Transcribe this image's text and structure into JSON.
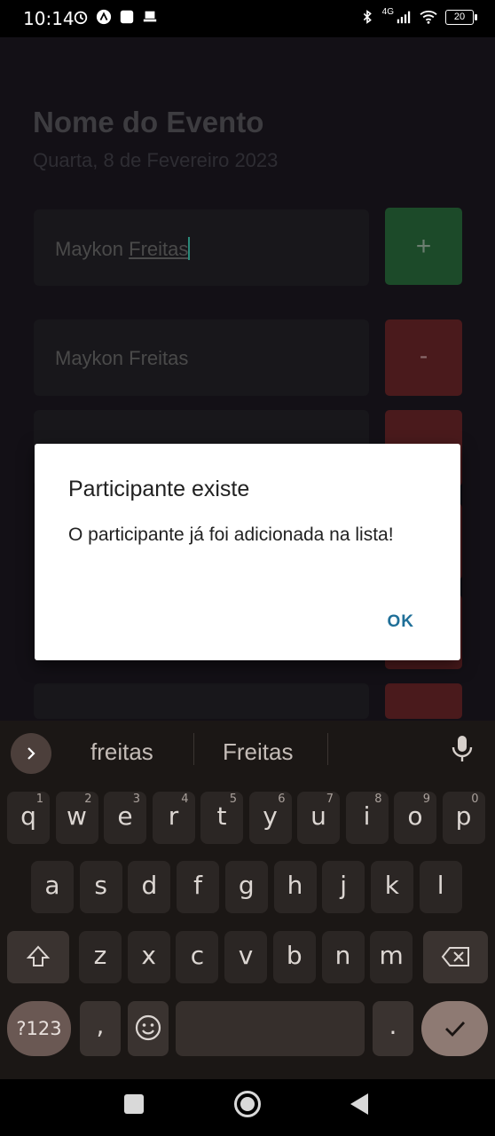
{
  "status_bar": {
    "time": "10:14",
    "network": "4G",
    "battery": "20"
  },
  "app": {
    "event_title": "Nome do Evento",
    "event_date": "Quarta, 8 de Fevereiro 2023",
    "input": {
      "value_first": "Maykon ",
      "value_second": "Freitas"
    },
    "add_button": "+",
    "participants": [
      {
        "name": "Maykon Freitas",
        "remove_label": "-"
      }
    ]
  },
  "dialog": {
    "title": "Participante existe",
    "message": "O participante já foi adicionada na lista!",
    "ok": "OK"
  },
  "keyboard": {
    "suggestions": [
      "freitas",
      "Freitas"
    ],
    "row1": [
      {
        "k": "q",
        "s": "1"
      },
      {
        "k": "w",
        "s": "2"
      },
      {
        "k": "e",
        "s": "3"
      },
      {
        "k": "r",
        "s": "4"
      },
      {
        "k": "t",
        "s": "5"
      },
      {
        "k": "y",
        "s": "6"
      },
      {
        "k": "u",
        "s": "7"
      },
      {
        "k": "i",
        "s": "8"
      },
      {
        "k": "o",
        "s": "9"
      },
      {
        "k": "p",
        "s": "0"
      }
    ],
    "row2": [
      "a",
      "s",
      "d",
      "f",
      "g",
      "h",
      "j",
      "k",
      "l"
    ],
    "row3": [
      "z",
      "x",
      "c",
      "v",
      "b",
      "n",
      "m"
    ],
    "symbols_key": "?123",
    "comma_key": ",",
    "period_key": "."
  }
}
